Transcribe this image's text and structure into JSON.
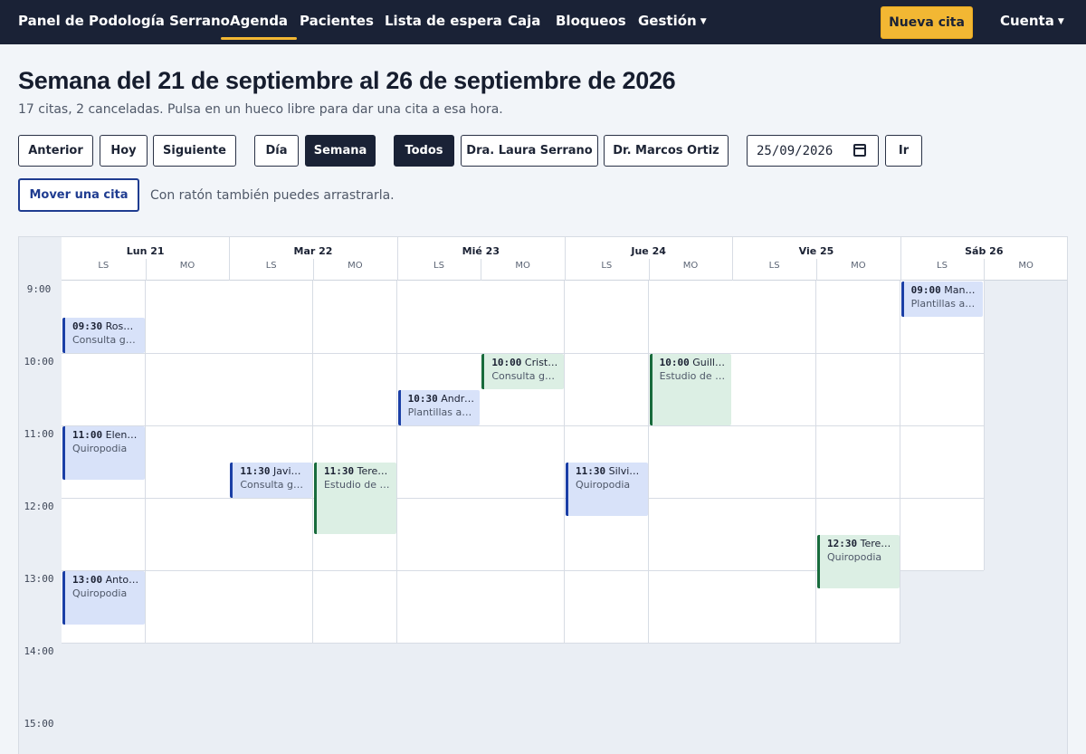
{
  "nav": {
    "brand": "Panel de Podología Serrano",
    "links": [
      "Agenda",
      "Pacientes",
      "Lista de espera",
      "Caja",
      "Bloqueos",
      "Gestión"
    ],
    "new_appointment": "Nueva cita",
    "account": "Cuenta"
  },
  "header": {
    "title": "Semana del 21 de septiembre al 26 de septiembre de 2026",
    "subtitle": "17 citas, 2 canceladas. Pulsa en un hueco libre para dar una cita a esa hora."
  },
  "toolbar": {
    "prev": "Anterior",
    "today": "Hoy",
    "next": "Siguiente",
    "day": "Día",
    "week": "Semana",
    "all": "Todos",
    "doctor1": "Dra. Laura Serrano",
    "doctor2": "Dr. Marcos Ortiz",
    "date_value": "25/09/2026",
    "go": "Ir",
    "move": "Mover una cita",
    "move_hint": "Con ratón también puedes arrastrarla."
  },
  "calendar": {
    "days": [
      {
        "name": "Lun 21",
        "subs": [
          "LS",
          "MO"
        ]
      },
      {
        "name": "Mar 22",
        "subs": [
          "LS",
          "MO"
        ]
      },
      {
        "name": "Mié 23",
        "subs": [
          "LS",
          "MO"
        ]
      },
      {
        "name": "Jue 24",
        "subs": [
          "LS",
          "MO"
        ]
      },
      {
        "name": "Vie 25",
        "subs": [
          "LS",
          "MO"
        ]
      },
      {
        "name": "Sáb 26",
        "subs": [
          "LS",
          "MO"
        ]
      }
    ],
    "hours": [
      "9:00",
      "10:00",
      "11:00",
      "12:00",
      "13:00",
      "14:00",
      "15:00"
    ],
    "appointments": [
      {
        "day": 0,
        "col": "LS",
        "time": "09:30",
        "patient": "Rosa …",
        "service": "Consulta ge…"
      },
      {
        "day": 0,
        "col": "LS",
        "time": "11:00",
        "patient": "Elena…",
        "service": "Quiropodia"
      },
      {
        "day": 0,
        "col": "LS",
        "time": "13:00",
        "patient": "Anton…",
        "service": "Quiropodia"
      },
      {
        "day": 1,
        "col": "LS",
        "time": "11:30",
        "patient": "Javier…",
        "service": "Consulta ge…"
      },
      {
        "day": 1,
        "col": "MO",
        "time": "11:30",
        "patient": "Teres…",
        "service": "Estudio de l…"
      },
      {
        "day": 2,
        "col": "LS",
        "time": "10:30",
        "patient": "André…",
        "service": "Plantillas a …"
      },
      {
        "day": 2,
        "col": "MO",
        "time": "10:00",
        "patient": "Cristi…",
        "service": "Consulta ge…"
      },
      {
        "day": 3,
        "col": "LS",
        "time": "11:30",
        "patient": "Silvia …",
        "service": "Quiropodia"
      },
      {
        "day": 3,
        "col": "MO",
        "time": "10:00",
        "patient": "Guille…",
        "service": "Estudio de l…"
      },
      {
        "day": 4,
        "col": "MO",
        "time": "12:30",
        "patient": "Teres…",
        "service": "Quiropodia"
      },
      {
        "day": 5,
        "col": "LS",
        "time": "09:00",
        "patient": "Manu…",
        "service": "Plantillas a …"
      }
    ]
  }
}
